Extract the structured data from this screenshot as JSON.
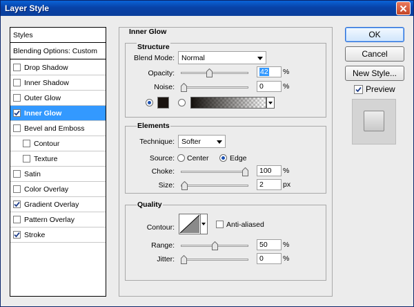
{
  "window": {
    "title": "Layer Style"
  },
  "styles": {
    "header": "Styles",
    "blending": "Blending Options: Custom",
    "items": [
      {
        "label": "Drop Shadow",
        "checked": false
      },
      {
        "label": "Inner Shadow",
        "checked": false
      },
      {
        "label": "Outer Glow",
        "checked": false
      },
      {
        "label": "Inner Glow",
        "checked": true,
        "selected": true
      },
      {
        "label": "Bevel and Emboss",
        "checked": false
      },
      {
        "label": "Contour",
        "checked": false,
        "indent": true
      },
      {
        "label": "Texture",
        "checked": false,
        "indent": true
      },
      {
        "label": "Satin",
        "checked": false
      },
      {
        "label": "Color Overlay",
        "checked": false
      },
      {
        "label": "Gradient Overlay",
        "checked": true
      },
      {
        "label": "Pattern Overlay",
        "checked": false
      },
      {
        "label": "Stroke",
        "checked": true
      }
    ]
  },
  "panel": {
    "title": "Inner Glow",
    "structure": {
      "title": "Structure",
      "blend_mode_label": "Blend Mode:",
      "blend_mode": "Normal",
      "opacity_label": "Opacity:",
      "opacity": "42",
      "opacity_unit": "%",
      "noise_label": "Noise:",
      "noise": "0",
      "noise_unit": "%",
      "color": "#1a1410"
    },
    "elements": {
      "title": "Elements",
      "technique_label": "Technique:",
      "technique": "Softer",
      "source_label": "Source:",
      "source_center": "Center",
      "source_edge": "Edge",
      "source_value": "Edge",
      "choke_label": "Choke:",
      "choke": "100",
      "choke_unit": "%",
      "size_label": "Size:",
      "size": "2",
      "size_unit": "px"
    },
    "quality": {
      "title": "Quality",
      "contour_label": "Contour:",
      "anti_aliased": "Anti-aliased",
      "anti_aliased_checked": false,
      "range_label": "Range:",
      "range": "50",
      "range_unit": "%",
      "jitter_label": "Jitter:",
      "jitter": "0",
      "jitter_unit": "%"
    }
  },
  "buttons": {
    "ok": "OK",
    "cancel": "Cancel",
    "new_style": "New Style...",
    "preview": "Preview",
    "preview_checked": true
  }
}
